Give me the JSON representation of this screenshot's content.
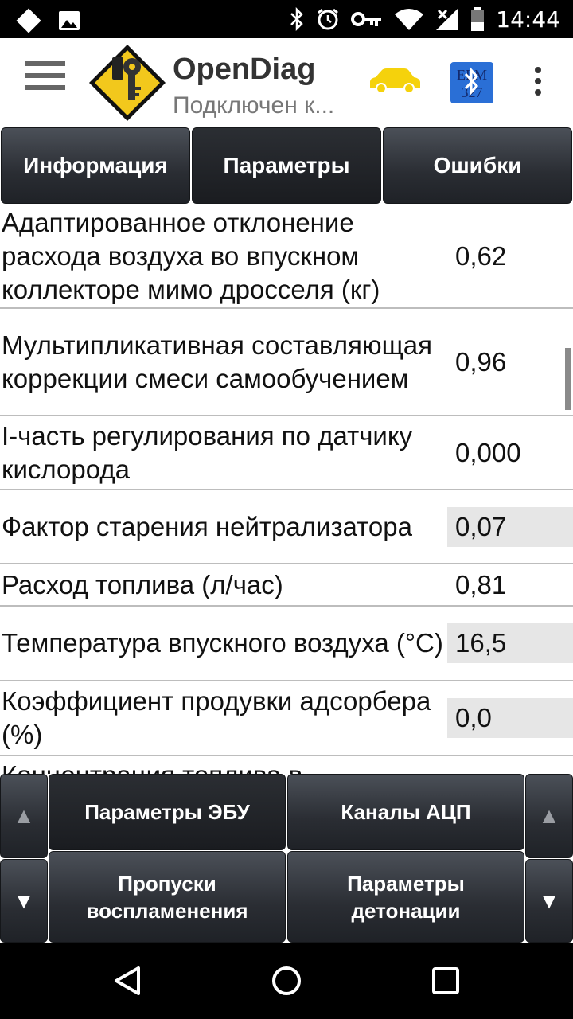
{
  "status_bar": {
    "time": "14:44",
    "left_icons": [
      "app-notification-icon",
      "image-notification-icon"
    ],
    "right_icons": [
      "bluetooth-icon",
      "alarm-icon",
      "key-icon",
      "wifi-icon",
      "signal-icon",
      "battery-icon"
    ]
  },
  "app_bar": {
    "title": "OpenDiag",
    "subtitle": "Подключен к...",
    "car_color": "#f5d20c",
    "elm_label": "ELM 327"
  },
  "tabs": [
    {
      "label": "Информация",
      "active": false
    },
    {
      "label": "Параметры",
      "active": true
    },
    {
      "label": "Ошибки",
      "active": false
    }
  ],
  "params": [
    {
      "name": "Адаптированное отклонение расхода воздуха во впускном коллекторе мимо дросселя (кг)",
      "value": "0,62"
    },
    {
      "name": "Мультипликативная составляющая коррекции смеси самообучением",
      "value": "0,96"
    },
    {
      "name": "I-часть регулирования по датчику кислорода",
      "value": "0,000"
    },
    {
      "name": "Фактор старения нейтрализатора",
      "value": "0,07"
    },
    {
      "name": "Расход топлива (л/час)",
      "value": "0,81"
    },
    {
      "name": "Температура впускного воздуха (°C)",
      "value": "16,5"
    },
    {
      "name": "Коэффициент продувки адсорбера (%)",
      "value": "0,0"
    },
    {
      "name": "Концентрация топлива в",
      "value": ""
    }
  ],
  "bottom_buttons": {
    "ecu_params": "Параметры ЭБУ",
    "adc_channels": "Каналы АЦП",
    "misfires": "Пропуски воспламенения",
    "knock_params": "Параметры детонации",
    "arrow_up": "▲",
    "arrow_down": "▼"
  }
}
